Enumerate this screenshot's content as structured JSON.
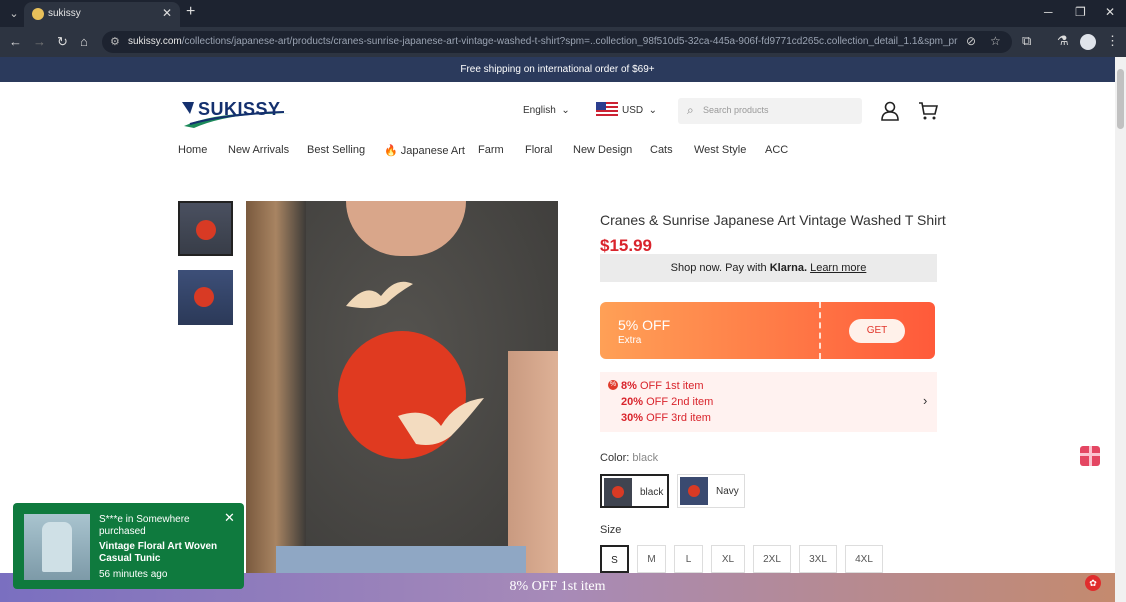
{
  "browser": {
    "tab_title": "sukissy",
    "url_host": "sukissy.com",
    "url_path": "/collections/japanese-art/products/cranes-sunrise-japanese-art-vintage-washed-t-shirt?spm=..collection_98f510d5-32ca-445a-906f-fd9771cd265c.collection_detail_1.1&spm_prev=..page_1045..."
  },
  "announcement": "Free shipping on international order of $69+",
  "header": {
    "logo_text": "SUKISSY",
    "language": "English",
    "currency": "USD",
    "search_placeholder": "Search products"
  },
  "nav": {
    "items": [
      "Home",
      "New Arrivals",
      "Best Selling",
      "🔥 Japanese Art",
      "Farm",
      "Floral",
      "New Design",
      "Cats",
      "West Style",
      "ACC"
    ]
  },
  "product": {
    "title": "Cranes & Sunrise Japanese Art Vintage Washed T Shirt",
    "price": "$15.99",
    "klarna_prefix": "Shop now. Pay with",
    "klarna_brand": "Klarna.",
    "klarna_link": "Learn more",
    "coupon": {
      "percent": "5% OFF",
      "subtitle": "Extra",
      "button": "GET"
    },
    "tiers": [
      {
        "pct": "8%",
        "text": " OFF 1st item"
      },
      {
        "pct": "20%",
        "text": " OFF 2nd item"
      },
      {
        "pct": "30%",
        "text": " OFF 3rd item"
      }
    ],
    "color_label": "Color:",
    "color_value": "black",
    "colors": [
      "black",
      "Navy"
    ],
    "size_label": "Size",
    "sizes": [
      "S",
      "M",
      "L",
      "XL",
      "2XL",
      "3XL",
      "4XL"
    ],
    "selected_size": "S"
  },
  "popup": {
    "who": "S***e in Somewhere purchased",
    "product": "Vintage Floral Art Woven Casual Tunic",
    "time": "56 minutes ago"
  },
  "bottom_bar": "8% OFF 1st item",
  "colors": {
    "accent": "#d9242c",
    "announce_bg": "#2b3a5c",
    "popup_bg": "#0f7a3e"
  }
}
